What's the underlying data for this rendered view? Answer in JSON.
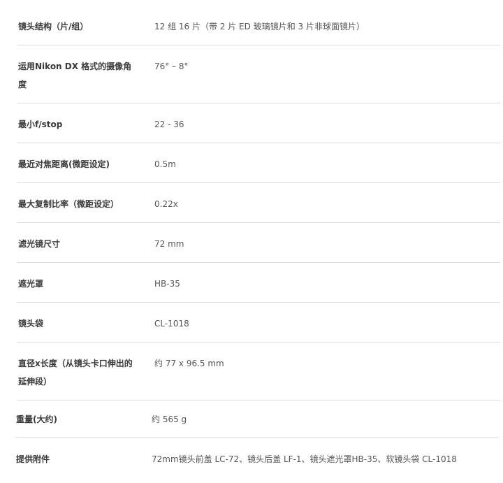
{
  "specs": [
    {
      "label": "镜头结构（片/组）",
      "value": "12 组 16 片（带 2 片 ED 玻璃镜片和 3 片非球面镜片）"
    },
    {
      "label": "运用Nikon DX 格式的摄像角度",
      "value": "76° – 8°"
    },
    {
      "label": "最小f/stop",
      "value": "22 - 36"
    },
    {
      "label": "最近对焦距离(微距设定)",
      "value": "0.5m"
    },
    {
      "label": "最大复制比率（微距设定）",
      "value": "0.22x"
    },
    {
      "label": "滤光镜尺寸",
      "value": "72 mm"
    },
    {
      "label": "遮光罩",
      "value": "HB-35"
    },
    {
      "label": "镜头袋",
      "value": "CL-1018"
    },
    {
      "label": "直径x长度（从镜头卡口伸出的延伸段）",
      "value": "约 77 x 96.5 mm"
    },
    {
      "label": "重量(大约)",
      "value": "约 565 g"
    },
    {
      "label": "提供附件",
      "value": "72mm镜头前盖 LC-72、镜头后盖 LF-1、镜头遮光罩HB-35、软镜头袋 CL-1018"
    }
  ],
  "colors": {
    "label": "#3a3a3a",
    "value": "#555555",
    "divider": "#dcdcdc"
  }
}
